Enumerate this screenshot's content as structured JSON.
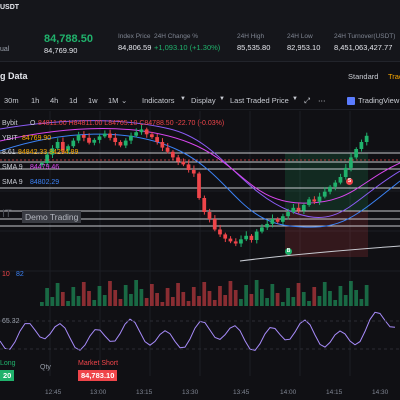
{
  "ticker": {
    "pair": "USDT",
    "type": "ual",
    "last_price": "84,788.50",
    "mark_price": "84,769.90",
    "stats": [
      {
        "label": "Index Price",
        "value": "84,806.59",
        "tone": "neutral"
      },
      {
        "label": "24H Change %",
        "value": "+1,093.10 (+1.30%)",
        "tone": "up"
      },
      {
        "label": "24H High",
        "value": "85,535.80",
        "tone": "neutral"
      },
      {
        "label": "24H Low",
        "value": "82,953.10",
        "tone": "neutral"
      },
      {
        "label": "24H Turnover(USDT)",
        "value": "8,451,063,427.77",
        "tone": "neutral"
      }
    ]
  },
  "chart_header": {
    "title": "g Data",
    "view_standard": "Standard",
    "view_tradingview": "Trad"
  },
  "toolbar": {
    "intervals": [
      "30m",
      "1h",
      "4h",
      "1d",
      "1w",
      "1M"
    ],
    "indicators": "Indicators",
    "display": "Display",
    "price_type": "Last Traded Price",
    "tradingview": "TradingView"
  },
  "legend": {
    "symbol_line": "Bybit",
    "ohlc_prefix": "O",
    "ohlc_values": "84811.00 H84811.00 L84765.10 C84788.50 -22.70 (-0.03%)",
    "price_line_prefix": "YBIT",
    "price_line_value": "84769.90",
    "boll_prefix": "8.61",
    "boll_values": "84842.33 84294.89",
    "sma_line1_label": "SMA 9",
    "sma_line1_value": "84479.46",
    "sma_line2_label": "SMA 9",
    "sma_line2_value": "84802.29"
  },
  "watermark": {
    "logo_text": "IT",
    "demo_label": "Demo Trading"
  },
  "volume": {
    "label_a": "10",
    "label_b": "82"
  },
  "rsi": {
    "value": "65.32"
  },
  "order_bar": {
    "long_label": "Long",
    "long_price": "20",
    "qty_label": "Qty",
    "short_label": "Market Short",
    "short_price": "84,783.10"
  },
  "time_axis": [
    "12:45",
    "13:00",
    "13:15",
    "13:30",
    "13:45",
    "14:00",
    "14:15",
    "14:30"
  ],
  "markers": {
    "buy": "B",
    "sell": "S"
  },
  "colors": {
    "up": "#20b26c",
    "down": "#ef454a",
    "accent": "#f7a600",
    "background": "#101014"
  },
  "chart_data": {
    "type": "candlestick",
    "series": [
      {
        "name": "price",
        "values": [
          84400,
          84520,
          84610,
          84700,
          84580,
          84640,
          84720,
          84800,
          84760,
          84690,
          84730,
          84780,
          84820,
          84760,
          84700,
          84650,
          84720,
          84790,
          84840,
          84880,
          84810,
          84770,
          84700,
          84620,
          84560,
          84480,
          84420,
          84380,
          84300,
          84250,
          83900,
          83700,
          83600,
          83450,
          83380,
          83320,
          83280,
          83250,
          83310,
          83360,
          83300,
          83420,
          83480,
          83530,
          83600,
          83560,
          83640,
          83700,
          83760,
          83720,
          83800,
          83880,
          83850,
          83920,
          83990,
          84060,
          84120,
          84200,
          84330,
          84480,
          84600,
          84700,
          84788.5
        ]
      }
    ],
    "last_price": 84788.5
  }
}
